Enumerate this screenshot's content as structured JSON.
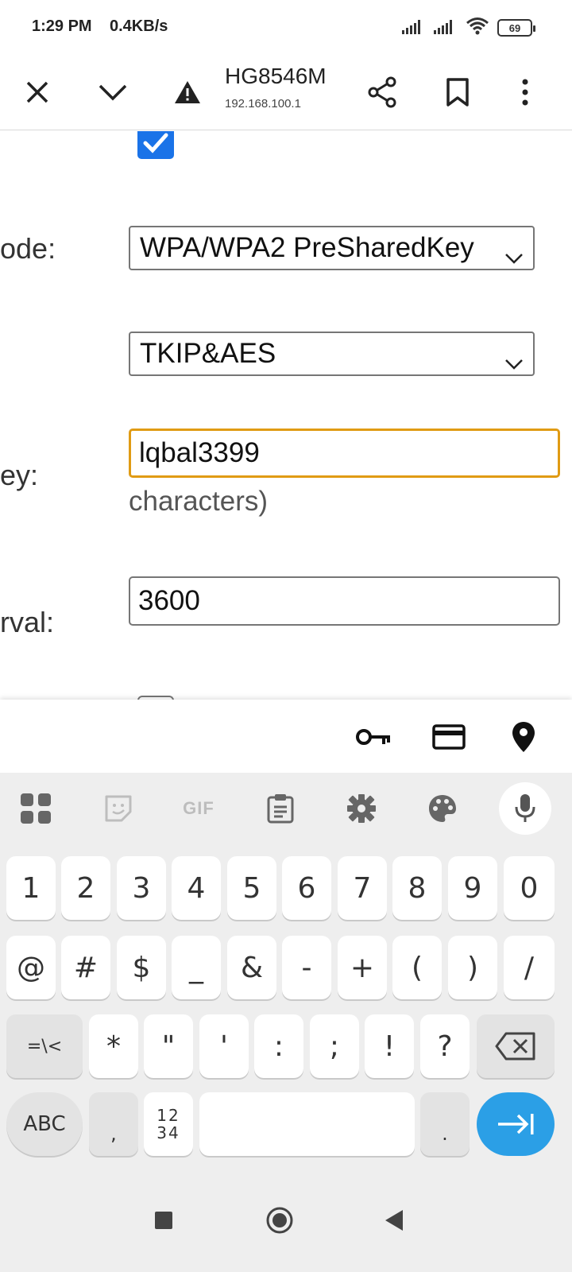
{
  "status_bar": {
    "time": "1:29 PM",
    "net_speed": "0.4KB/s",
    "battery": "69",
    "icons": [
      "signal-icon",
      "signal-icon",
      "wifi-icon",
      "battery-icon"
    ]
  },
  "toolbar": {
    "title": "HG8546M",
    "url": "192.168.100.1",
    "icons": [
      "close-icon",
      "chevron-down-icon",
      "warning-icon",
      "share-icon",
      "bookmark-icon",
      "more-vert-icon"
    ]
  },
  "form": {
    "mode_label": "ode:",
    "mode_value": "WPA/WPA2 PreSharedKey",
    "encryption_value": "TKIP&AES",
    "key_label": "ey:",
    "key_value": "lqbal3399",
    "key_hint": "characters)",
    "interval_label": "rval:",
    "interval_value": "3600"
  },
  "autofill": {
    "icons": [
      "key-icon",
      "credit-card-icon",
      "location-pin-icon"
    ]
  },
  "keyboard": {
    "toolbar_icons": [
      "apps-grid-icon",
      "sticker-icon",
      "gif-icon",
      "clipboard-icon",
      "settings-icon",
      "palette-icon",
      "mic-icon"
    ],
    "gif_label": "GIF",
    "row1": [
      "1",
      "2",
      "3",
      "4",
      "5",
      "6",
      "7",
      "8",
      "9",
      "0"
    ],
    "row2": [
      "@",
      "#",
      "$",
      "_",
      "&",
      "-",
      "+",
      "(",
      ")",
      "/"
    ],
    "row3_shift": "=\\<",
    "row3": [
      "*",
      "\"",
      "'",
      ":",
      ";",
      "!",
      "?"
    ],
    "abc_label": "ABC",
    "comma": ",",
    "num_toggle_top": "12",
    "num_toggle_bottom": "34",
    "period": "."
  },
  "colors": {
    "accent_blue": "#1a73e8",
    "focus_border": "#e09b14",
    "enter_key": "#2b9fe6"
  }
}
